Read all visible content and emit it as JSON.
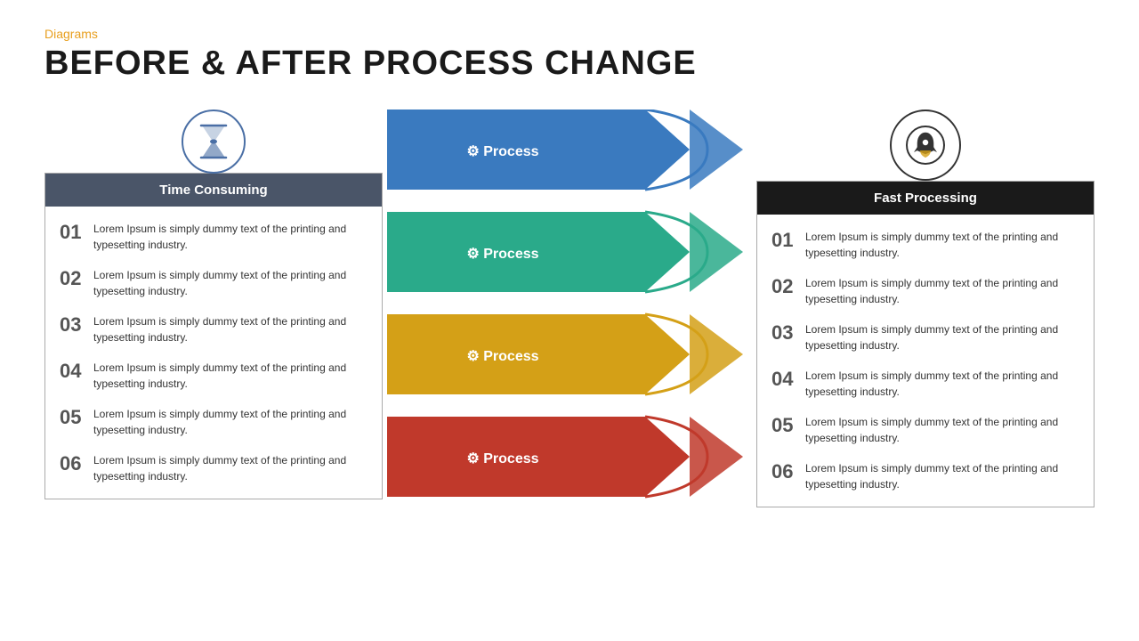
{
  "category": "Diagrams",
  "title": "BEFORE & AFTER PROCESS CHANGE",
  "left_panel": {
    "header": "Time Consuming",
    "items": [
      {
        "number": "01",
        "text": "Lorem Ipsum is simply dummy text of the printing and typesetting industry."
      },
      {
        "number": "02",
        "text": "Lorem Ipsum is simply dummy text of the printing and typesetting industry."
      },
      {
        "number": "03",
        "text": "Lorem Ipsum is simply dummy text of the printing and typesetting industry."
      },
      {
        "number": "04",
        "text": "Lorem Ipsum is simply dummy text of the printing and typesetting industry."
      },
      {
        "number": "05",
        "text": "Lorem Ipsum is simply dummy text of the printing and typesetting industry."
      },
      {
        "number": "06",
        "text": "Lorem Ipsum is simply dummy text of the printing and typesetting industry."
      }
    ]
  },
  "processes": [
    {
      "label": "Process",
      "color": "#3a7abf"
    },
    {
      "label": "Process",
      "color": "#2aaa8a"
    },
    {
      "label": "Process",
      "color": "#d4a017"
    },
    {
      "label": "Process",
      "color": "#c0392b"
    }
  ],
  "right_panel": {
    "header": "Fast Processing",
    "items": [
      {
        "number": "01",
        "text": "Lorem Ipsum is simply dummy text of the printing and typesetting industry."
      },
      {
        "number": "02",
        "text": "Lorem Ipsum is simply dummy text of the printing and typesetting industry."
      },
      {
        "number": "03",
        "text": "Lorem Ipsum is simply dummy text of the printing and typesetting industry."
      },
      {
        "number": "04",
        "text": "Lorem Ipsum is simply dummy text of the printing and typesetting industry."
      },
      {
        "number": "05",
        "text": "Lorem Ipsum is simply dummy text of the printing and typesetting industry."
      },
      {
        "number": "06",
        "text": "Lorem Ipsum is simply dummy text of the printing and typesetting industry."
      }
    ]
  },
  "colors": {
    "orange": "#e8a020",
    "blue": "#3a7abf",
    "teal": "#2aaa8a",
    "gold": "#d4a017",
    "red": "#c0392b",
    "dark_header": "#4a5568",
    "black_header": "#1a1a1a"
  }
}
